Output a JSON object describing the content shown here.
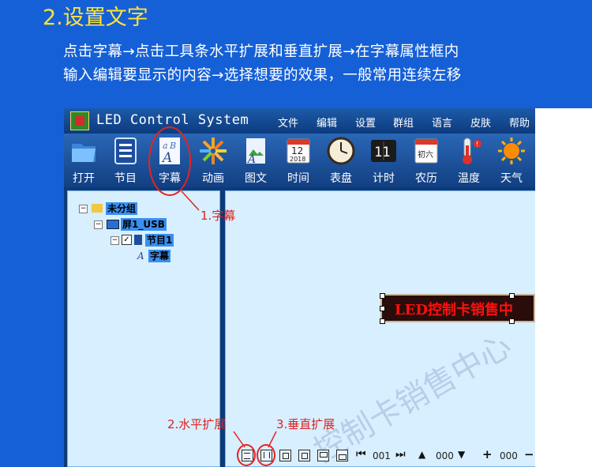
{
  "heading": "2.设置文字",
  "instructions": [
    "点击字幕→点击工具条水平扩展和垂直扩展→在字幕属性框内",
    "输入编辑要显示的内容→选择想要的效果，一般常用连续左移"
  ],
  "app": {
    "title": "LED Control System",
    "menu": [
      "文件",
      "编辑",
      "设置",
      "群组",
      "语言",
      "皮肤",
      "帮助"
    ],
    "toolbar": [
      {
        "label": "打开",
        "icon": "folder-icon"
      },
      {
        "label": "节目",
        "icon": "program-icon"
      },
      {
        "label": "字幕",
        "icon": "subtitle-icon"
      },
      {
        "label": "动画",
        "icon": "animation-icon"
      },
      {
        "label": "图文",
        "icon": "image-text-icon"
      },
      {
        "label": "时间",
        "icon": "calendar-time-icon"
      },
      {
        "label": "表盘",
        "icon": "clock-dial-icon"
      },
      {
        "label": "计时",
        "icon": "timer-icon"
      },
      {
        "label": "农历",
        "icon": "lunar-calendar-icon"
      },
      {
        "label": "温度",
        "icon": "thermometer-icon"
      },
      {
        "label": "天气",
        "icon": "sun-weather-icon"
      }
    ],
    "tree": {
      "group": "未分组",
      "screen": "屏1_USB",
      "program": "节目1",
      "item": "字幕"
    },
    "led_text": "LED控制卡销售中",
    "bottom": {
      "page_value": "001",
      "step_value": "000",
      "zoom_value": "000"
    },
    "lunar_icon_text": "初六",
    "calendar_icon_day": "12",
    "calendar_icon_year": "2018",
    "timer_icon_text": "11"
  },
  "annotations": {
    "a1": "1.字幕",
    "a2": "2.水平扩展",
    "a3": "3.垂直扩展"
  },
  "watermark": "控制卡销售中心"
}
